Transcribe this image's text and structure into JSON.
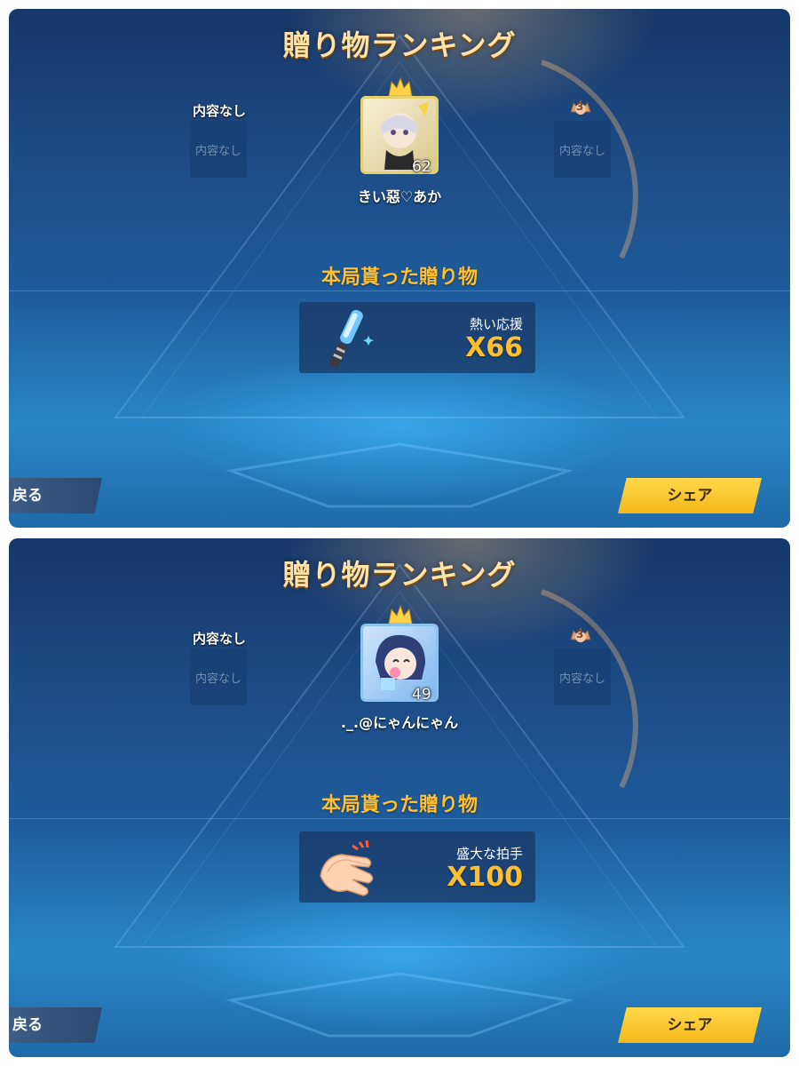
{
  "panels": [
    {
      "title": "贈り物ランキング",
      "rank2": {
        "label": "内容なし",
        "box": "内容なし"
      },
      "rank3": {
        "badge": "3",
        "box": "内容なし"
      },
      "winner": {
        "name": "きい惡♡あか",
        "level": "62",
        "crown_rank": "1"
      },
      "section_title": "本局貰った贈り物",
      "gift": {
        "name": "熱い応援",
        "count": "X66",
        "icon": "glow-stick-icon"
      },
      "back_label": "戻る",
      "share_label": "シェア"
    },
    {
      "title": "贈り物ランキング",
      "rank2": {
        "label": "内容なし",
        "box": "内容なし"
      },
      "rank3": {
        "badge": "3",
        "box": "内容なし"
      },
      "winner": {
        "name": "._.@にゃんにゃん",
        "level": "49",
        "crown_rank": "1"
      },
      "section_title": "本局貰った贈り物",
      "gift": {
        "name": "盛大な拍手",
        "count": "X100",
        "icon": "clapping-hands-icon"
      },
      "back_label": "戻る",
      "share_label": "シェア"
    }
  ]
}
